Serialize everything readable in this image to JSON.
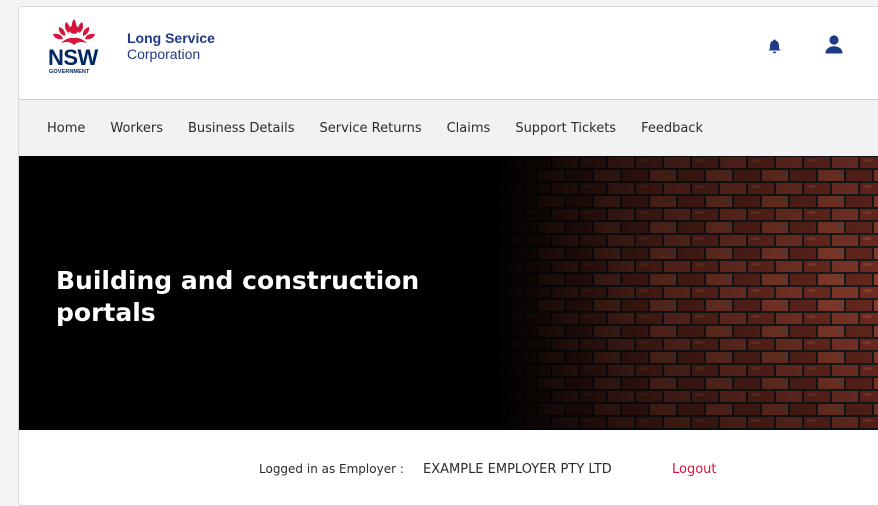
{
  "brand": {
    "logo_text": "NSW",
    "logo_subtext": "GOVERNMENT",
    "org_line1": "Long Service",
    "org_line2": "Corporation",
    "colors": {
      "navy": "#002664",
      "red": "#d7153a",
      "brand_text": "#1f3a86"
    }
  },
  "header_icons": {
    "notifications": "bell-icon",
    "account": "user-icon"
  },
  "nav": {
    "items": [
      {
        "label": "Home"
      },
      {
        "label": "Workers"
      },
      {
        "label": "Business Details"
      },
      {
        "label": "Service Returns"
      },
      {
        "label": "Claims"
      },
      {
        "label": "Support Tickets"
      },
      {
        "label": "Feedback"
      }
    ]
  },
  "hero": {
    "title": "Building and construction portals"
  },
  "status": {
    "logged_in_label": "Logged in as Employer :",
    "employer_name": "EXAMPLE EMPLOYER PTY LTD",
    "logout_label": "Logout"
  }
}
